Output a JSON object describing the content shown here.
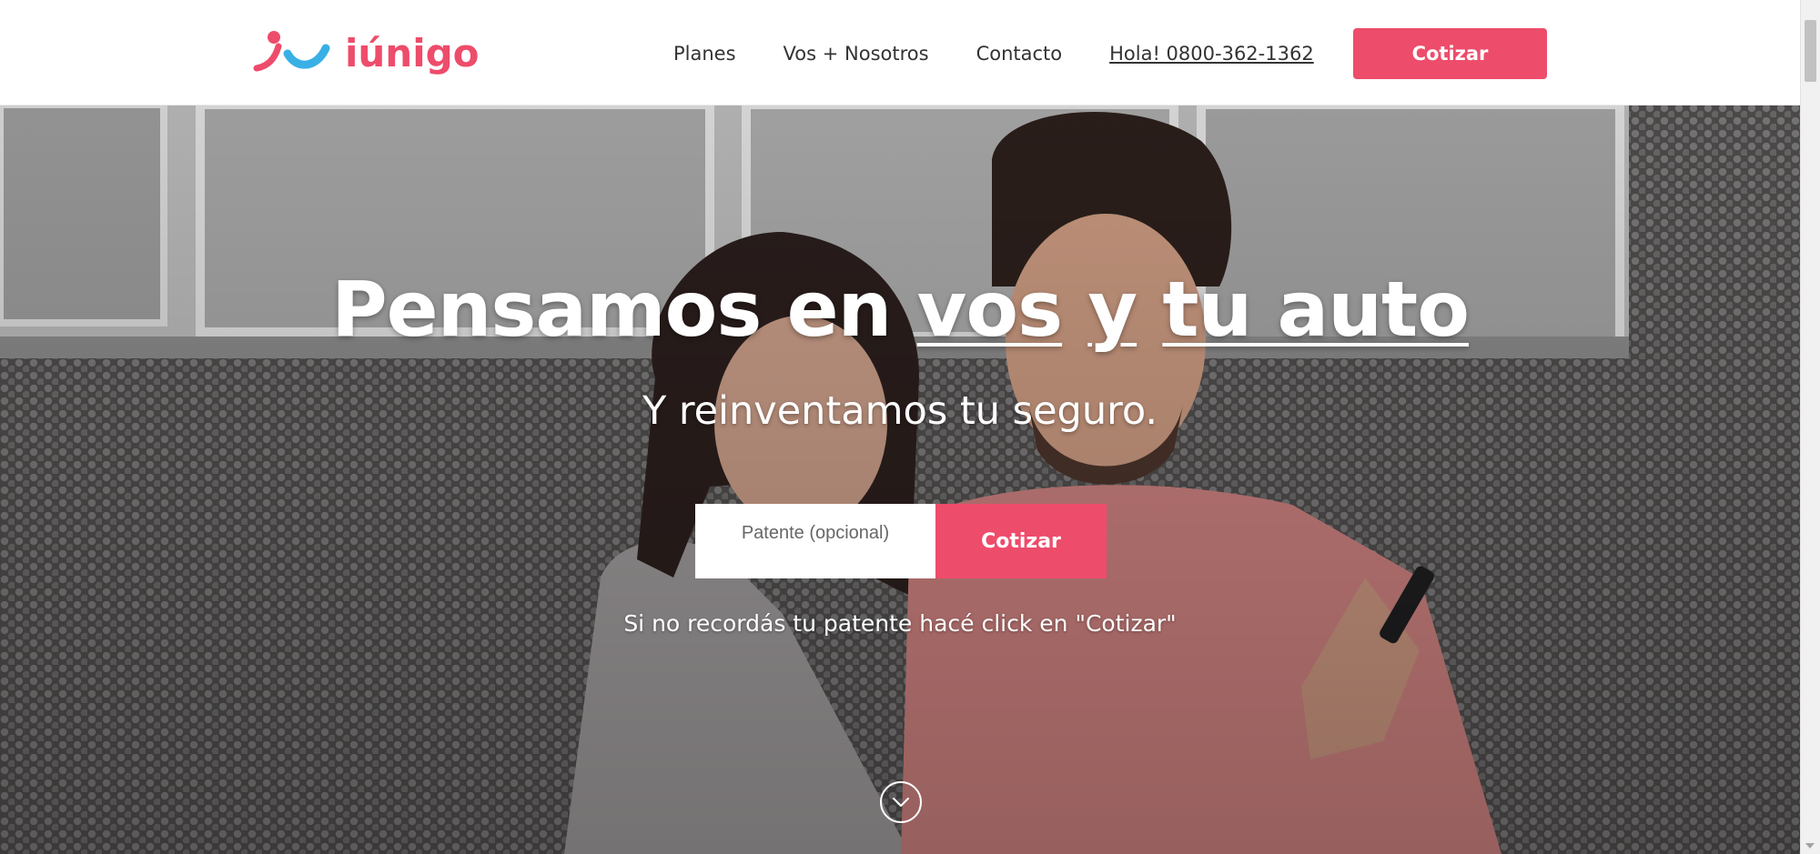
{
  "brand": {
    "name": "iúnigo",
    "color": "#ee4c6b",
    "accent": "#39b0e5"
  },
  "nav": {
    "items": [
      {
        "label": "Planes"
      },
      {
        "label": "Vos + Nosotros"
      },
      {
        "label": "Contacto"
      }
    ],
    "phone": "Hola! 0800-362-1362",
    "cta_label": "Cotizar"
  },
  "hero": {
    "title_part1": "Pensamos en",
    "title_part2": "vos",
    "title_part3": "y",
    "title_part4": "tu auto",
    "subtitle": "Y reinventamos tu seguro.",
    "plate_placeholder": "Patente (opcional)",
    "form_cta_label": "Cotizar",
    "hint": "Si no recordás tu patente hacé click en \"Cotizar\"",
    "scroll_icon": "chevron-down-icon"
  }
}
